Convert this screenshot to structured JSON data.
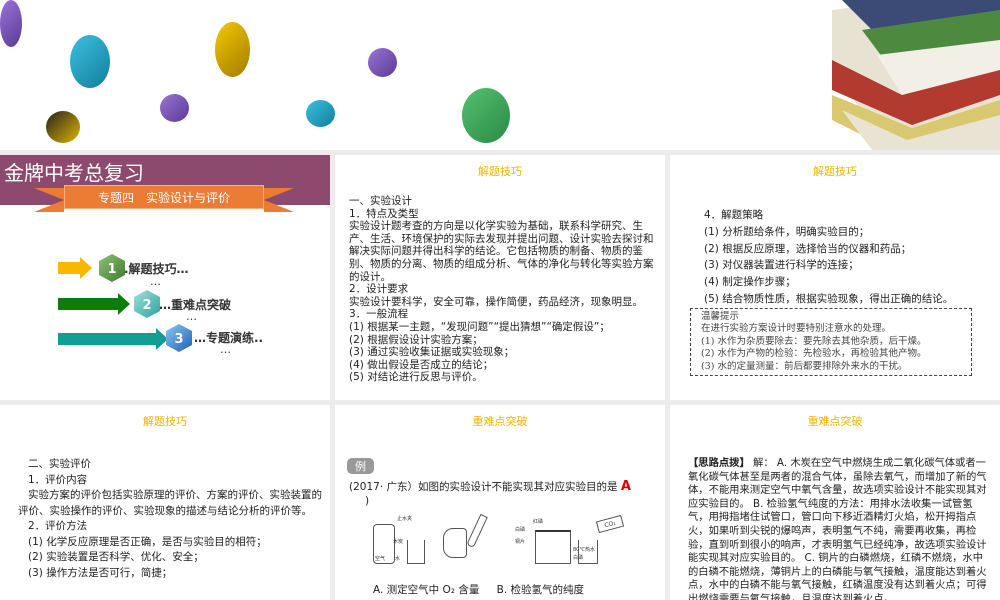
{
  "background": {
    "colors": [
      "#7b52b8",
      "#1fa3c6",
      "#e2b100",
      "#7b52b8",
      "#7b52b8",
      "#1f9ec3",
      "#b89400",
      "#3aa65b"
    ]
  },
  "slide1": {
    "title": "金牌中考总复习",
    "ribbon": "专题四　实验设计与评价",
    "menu": [
      {
        "num": "1",
        "label": ".解题技巧…",
        "dots": "…"
      },
      {
        "num": "2",
        "label": "…重难点突破",
        "dots": "…"
      },
      {
        "num": "3",
        "label": "…专题演练..",
        "dots": "…"
      }
    ]
  },
  "slide2": {
    "heading": "解题技巧",
    "lines": [
      "一、实验设计",
      "1．特点及类型",
      "实验设计题考查的方向是以化学实验为基础，联系科学研究、生产、生活、环境保护的实际去发现并提出问题、设计实验去探讨和解决实际问题并得出科学的结论。它包括物质的制备、物质的鉴别、物质的分离、物质的组成分析、气体的净化与转化等实验方案的设计。",
      "2．设计要求",
      "实验设计要科学，安全可靠，操作简便，药品经济，现象明显。",
      "3．一般流程",
      "(1) 根据某一主题，“发现问题”“提出猜想”“确定假设”；",
      "(2) 根据假设设计实验方案；",
      "(3) 通过实验收集证据或实验现象；",
      "(4) 做出假设是否成立的结论；",
      "(5) 对结论进行反思与评价。"
    ]
  },
  "slide3": {
    "heading": "解题技巧",
    "lines": [
      "4．解题策略",
      "(1) 分析题给条件，明确实验目的；",
      "(2) 根据反应原理，选择恰当的仪器和药品；",
      "(3) 对仪器装置进行科学的连接；",
      "(4) 制定操作步骤；",
      "(5) 结合物质性质，根据实验现象，得出正确的结论。"
    ],
    "tip": [
      "温馨提示",
      "在进行实验方案设计时要特别注意水的处理。",
      "(1) 水作为杂质要除去：要先除去其他杂质，后干燥。",
      "(2) 水作为产物的检验：先检验水，再检验其他产物。",
      "(3) 水的定量测量：前后都要排除外来水的干扰。"
    ]
  },
  "slide4": {
    "heading": "解题技巧",
    "lines": [
      "二、实验评价",
      "1．评价内容",
      "实验方案的评价包括实验原理的评价、方案的评价、实验装置的评价、实验操作的评价、实验现象的描述与结论分析的评价等。",
      "2．评价方法",
      "(1) 化学反应原理是否正确，是否与实验目的相符；",
      "(2) 实验装置是否科学、优化、安全；",
      "(3) 操作方法是否可行，简捷；"
    ]
  },
  "slide5": {
    "heading": "重难点突破",
    "badge": "例",
    "question": "(2017· 广东）如图的实验设计不能实现其对应实验目的是",
    "answer": "A",
    "close": ")",
    "fig_labels": [
      "止水夹",
      "木炭",
      "空气",
      "水",
      "红磷",
      "白磷",
      "铜片",
      "80℃热水",
      "CO₂"
    ],
    "options": [
      "A. 测定空气中 O₂ 含量",
      "B. 检验氢气的纯度"
    ]
  },
  "slide6": {
    "heading": "重难点突破",
    "label": "【思路点拨】",
    "text": " 解： A. 木炭在空气中燃烧生成二氧化碳气体或者一氧化碳气体甚至是两者的混合气体，虽除去氧气，而增加了新的气体，不能用来测定空气中氧气含量，故选项实验设计不能实现其对应实验目的。 B. 检验氢气纯度的方法：用排水法收集一试管氢气，用拇指堵住试管口，管口向下移近酒精灯火焰，松开拇指点火，如果听到尖锐的爆鸣声，表明氢气不纯，需要再收集，再检验，直到听到很小的响声，才表明氢气已经纯净，故选项实验设计能实现其对应实验目的。 C. 铜片的白磷燃烧，红磷不燃烧，水中的白磷不能燃烧，薄铜片上的白磷能与氧气接触，温度能达到着火点，水中的白磷不能与氧气接触，红磷温度没有达到着火点；可得出燃烧需要与氧气接触，且温度达到着火点。"
  }
}
